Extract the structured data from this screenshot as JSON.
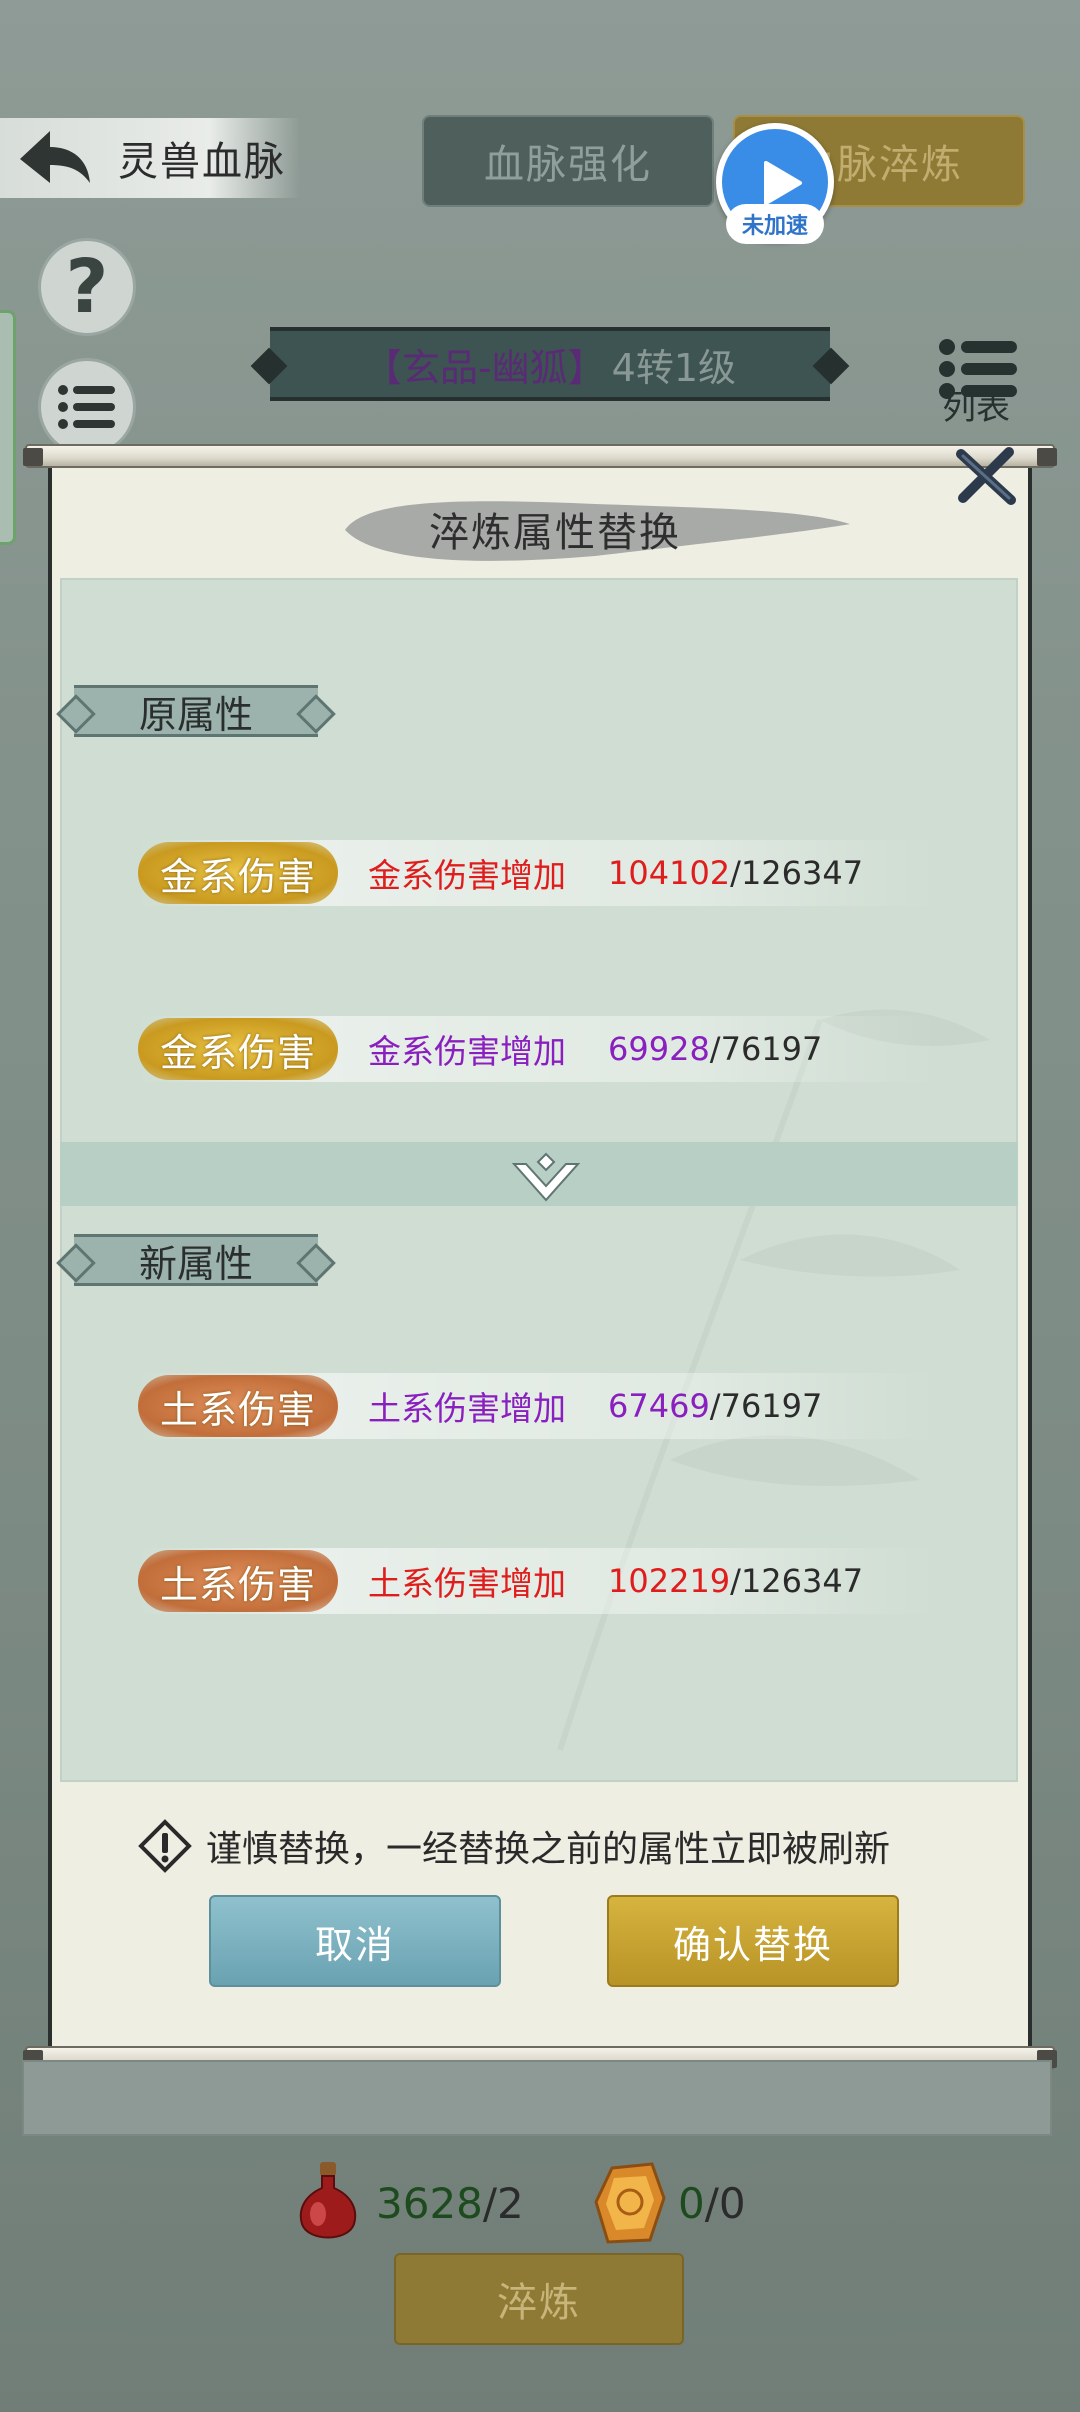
{
  "header": {
    "back_label": "灵兽血脉",
    "tabs": [
      {
        "label": "血脉强化"
      },
      {
        "label": "血脉淬炼"
      }
    ],
    "speed_badge": "未加速",
    "help_symbol": "?",
    "list_label": "列表"
  },
  "pet": {
    "name": "【玄品-幽狐】",
    "level": "4转1级"
  },
  "dialog": {
    "title": "淬炼属性替换",
    "old_section": "原属性",
    "new_section": "新属性",
    "old_attributes": [
      {
        "badge": "金系伤害",
        "desc": "金系伤害增加",
        "current": "104102",
        "max": "/126347",
        "quality_color": "#e01d1d"
      },
      {
        "badge": "金系伤害",
        "desc": "金系伤害增加",
        "current": "69928",
        "max": "/76197",
        "quality_color": "#8a1fbf"
      }
    ],
    "new_attributes": [
      {
        "badge": "土系伤害",
        "desc": "土系伤害增加",
        "current": "67469",
        "max": "/76197",
        "quality_color": "#8a1fbf"
      },
      {
        "badge": "土系伤害",
        "desc": "土系伤害增加",
        "current": "102219",
        "max": "/126347",
        "quality_color": "#e01d1d"
      }
    ],
    "warning": "谨慎替换，一经替换之前的属性立即被刷新",
    "cancel_label": "取消",
    "confirm_label": "确认替换"
  },
  "resources": {
    "potion_current": "3628",
    "potion_max": "/2",
    "stone_current": "0",
    "stone_max": "/0"
  },
  "bottom": {
    "refine_label": "淬炼"
  },
  "icons": {
    "back": "back-arrow-icon",
    "help": "question-icon",
    "menu": "menu-icon",
    "list": "list-icon",
    "close": "close-icon",
    "divider": "chevron-down-icon",
    "warning": "warning-icon",
    "potion": "potion-icon",
    "stone": "gem-stone-icon",
    "play": "play-icon"
  },
  "colors": {
    "red_quality": "#e01d1d",
    "purple_quality": "#8a1fbf",
    "gold_badge": "#d9b233",
    "earth_badge": "#cf7a46",
    "confirm_button": "#c9a534",
    "cancel_button": "#7db2c0"
  }
}
